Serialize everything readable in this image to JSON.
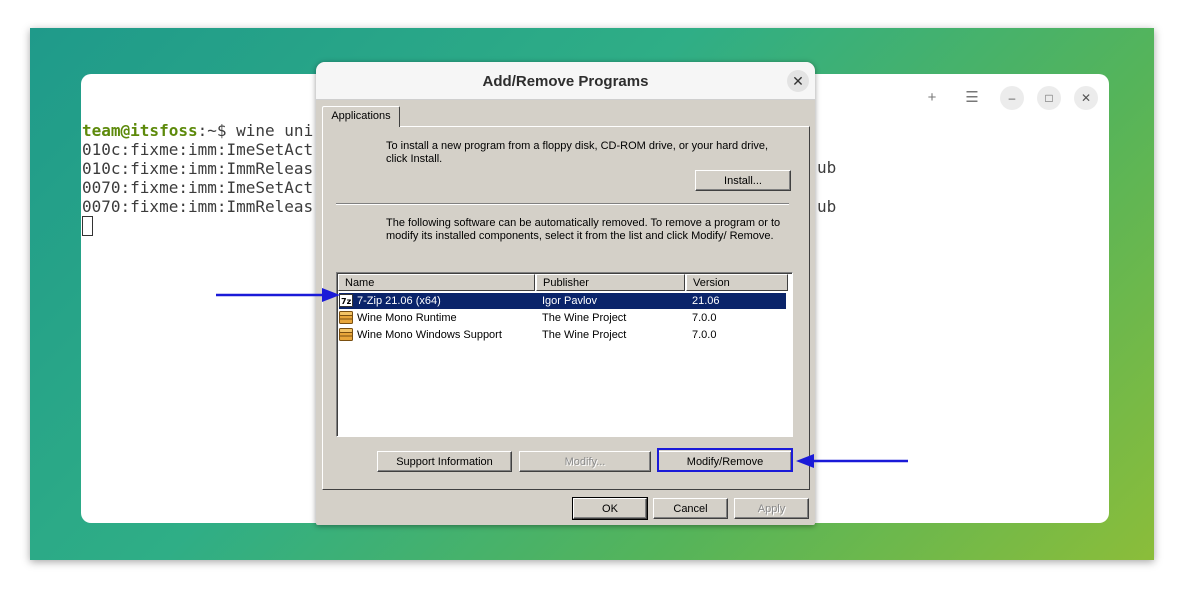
{
  "terminal": {
    "prompt_user": "team@itsfoss",
    "prompt_sep": ":~$",
    "command": " wine uni",
    "lines": [
      "010c:fixme:imm:ImeSetAct",
      "010c:fixme:imm:ImmReleas",
      "0070:fixme:imm:ImeSetAct",
      "0070:fixme:imm:ImmReleas"
    ],
    "trail_1": "ub",
    "trail_2": "ub",
    "controls": {
      "new_tab": "+",
      "menu": "☰",
      "minimize": "–",
      "maximize": "□",
      "close": "✕"
    }
  },
  "dialog": {
    "title": "Add/Remove Programs",
    "close_glyph": "✕",
    "tab_label": "Applications",
    "install_text": "To install a new program from a floppy disk, CD-ROM drive, or your hard drive, click Install.",
    "install_button": "Install...",
    "remove_text": "The following software can be automatically removed. To remove a program or to modify its installed components, select it from the list and click Modify/ Remove.",
    "columns": [
      "Name",
      "Publisher",
      "Version"
    ],
    "rows": [
      {
        "name": "7-Zip 21.06 (x64)",
        "publisher": "Igor Pavlov",
        "version": "21.06",
        "selected": true,
        "icon": "7zip-icon"
      },
      {
        "name": "Wine Mono Runtime",
        "publisher": "The Wine Project",
        "version": "7.0.0",
        "selected": false,
        "icon": "package-icon"
      },
      {
        "name": "Wine Mono Windows Support",
        "publisher": "The Wine Project",
        "version": "7.0.0",
        "selected": false,
        "icon": "package-icon"
      }
    ],
    "support_button": "Support Information",
    "modify_button": "Modify...",
    "modify_remove_button": "Modify/Remove",
    "ok_button": "OK",
    "cancel_button": "Cancel",
    "apply_button": "Apply"
  },
  "colors": {
    "selection": "#0a246a",
    "annotation": "#1a1ad8",
    "dialog_face": "#d4d0c8"
  }
}
